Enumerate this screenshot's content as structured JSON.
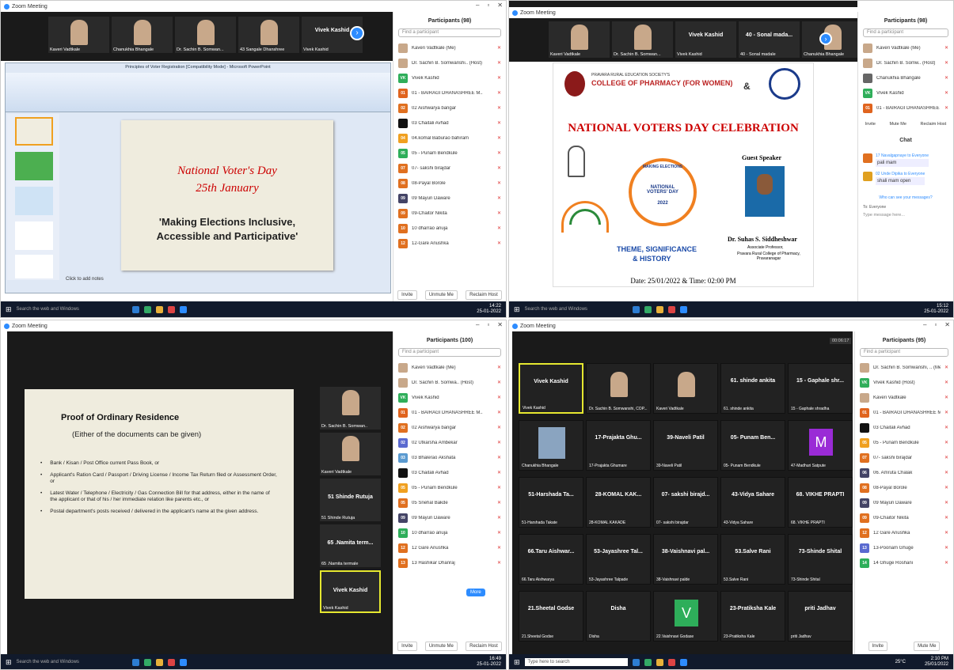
{
  "q1": {
    "title": "Zoom Meeting",
    "thumbs": [
      {
        "name": "Kaveri Vadtkale"
      },
      {
        "name": "Chanukhia Bhangale"
      },
      {
        "name": "Dr. Sachin B. Somwan..."
      },
      {
        "name": "43 Sangale Dhanshree"
      },
      {
        "name": "Vivek Kashid",
        "big": "Vivek Kashid"
      }
    ],
    "ppt_title": "Principles of Voter Registration [Compatibility Mode] - Microsoft PowerPoint",
    "slide_line1": "National Voter's Day",
    "slide_line2": "25th January",
    "slide_line3": "'Making Elections Inclusive, Accessible and Participative'",
    "notes": "Click to add notes",
    "panel_title": "Participants (98)",
    "search": "Find a participant",
    "participants": [
      {
        "n": "Kaveri Vadtkale (Me)",
        "c": "#c8a88a"
      },
      {
        "n": "Dr. Sachin B. Somwanshi.. (Host)",
        "c": "#c8a88a"
      },
      {
        "n": "Vivek Kashid",
        "c": "#2fae5a",
        "i": "VK"
      },
      {
        "n": "01 - BAIRAGI DHANASHREE M..",
        "c": "#e0641e",
        "i": "01"
      },
      {
        "n": "02 Aishwarya bangar",
        "c": "#e07020",
        "i": "02"
      },
      {
        "n": "03 Chaitali Avhad",
        "c": "#111"
      },
      {
        "n": "04.komal Baburao bahiram",
        "c": "#f0a020",
        "i": "04"
      },
      {
        "n": "05 - Punam Bendkule",
        "c": "#2eae5a",
        "i": "05"
      },
      {
        "n": "07- sakshi birajdar",
        "c": "#e07020",
        "i": "07"
      },
      {
        "n": "08-Payal Borole",
        "c": "#e07020",
        "i": "08"
      },
      {
        "n": "09 Mayuri Daware",
        "c": "#444466",
        "i": "09"
      },
      {
        "n": "09-Chaitor Nikita",
        "c": "#e07020",
        "i": "09"
      },
      {
        "n": "10 dharrao anuja",
        "c": "#e07020",
        "i": "10"
      },
      {
        "n": "12-Gare Anushka",
        "c": "#e07020",
        "i": "12"
      }
    ],
    "btn_invite": "Invite",
    "btn_unmute": "Unmute Me",
    "btn_reclaim": "Reclaim Host",
    "search_win": "Search the web and Windows",
    "clock": "14:22",
    "date": "25-01-2022"
  },
  "q2": {
    "title": "Zoom Meeting",
    "thumbs": [
      {
        "name": "Kaveri Vadtkale"
      },
      {
        "name": "Dr. Sachin B. Somwan..."
      },
      {
        "name": "Vivek Kashid",
        "big": "Vivek Kashid"
      },
      {
        "name": "40 - Sonal madale",
        "big": "40 - Sonal mada..."
      },
      {
        "name": "Chanukhia Bhangale"
      }
    ],
    "society": "PRAVARA RURAL EDUCATION SOCIETY'S",
    "college": "COLLEGE OF PHARMACY (FOR WOMEN)",
    "amp": "&",
    "heading": "NATIONAL VOTERS DAY CELEBRATION",
    "badge_top": "MAKING ELECTIONS",
    "badge_mid": "NATIONAL VOTERS' DAY",
    "badge_year": "2022",
    "theme1": "THEME, SIGNIFICANCE",
    "theme2": "& HISTORY",
    "guest_label": "Guest Speaker",
    "speaker": "Dr. Suhas S. Siddheshwar",
    "speaker_role": "Associate Professor,",
    "speaker_org": "Pravara Rural College of Pharmacy, Pravaranagar",
    "datetime": "Date: 25/01/2022 & Time: 02:00 PM",
    "panel_title": "Participants (98)",
    "search": "Find a participant",
    "participants": [
      {
        "n": "Kaveri Vadtkale (Me)",
        "c": "#c8a88a"
      },
      {
        "n": "Dr. Sachin B. Somw.. (Host)",
        "c": "#c8a88a"
      },
      {
        "n": "Chanukhia Bhangale",
        "c": "#666"
      },
      {
        "n": "Vivek Kashid",
        "c": "#2fae5a",
        "i": "VK"
      },
      {
        "n": "01 - BAIRAGI DHANASHREE M..",
        "c": "#e0641e",
        "i": "01"
      }
    ],
    "btn_invite": "Invite",
    "btn_mute": "Mute Me",
    "btn_reclaim": "Reclaim Host",
    "chat_title": "Chat",
    "chat": [
      {
        "from": "17 Navalgapnaye to Everyone",
        "msg": "pali mam",
        "c": "#e07020"
      },
      {
        "from": "02 Unde Dipika to Everyone",
        "msg": "shali mam open",
        "c": "#e0a020"
      }
    ],
    "who_see": "Who can see your messages?",
    "to": "To: Everyone",
    "type_msg": "Type message here...",
    "search_win": "Search the web and Windows",
    "clock": "15:12",
    "date": "25-01-2022"
  },
  "q3": {
    "title": "Zoom Meeting",
    "slide_title": "Proof of Ordinary Residence",
    "slide_sub": "(Either of the documents can be given)",
    "bullets": [
      "Bank / Kisan / Post Office current Pass Book, or",
      "Applicant's Ration Card / Passport / Driving License / Income Tax Return filed or Assessment Order, or",
      "Latest Water / Telephone / Electricity / Gas Connection Bill for that address, either in the name of the applicant or that of his / her immediate relation like parents etc., or",
      "Postal department's posts received / delivered in the applicant's name at the given address."
    ],
    "side_thumbs": [
      {
        "name": "Dr. Sachin B. Somwan..",
        "face": true
      },
      {
        "name": "Kaveri Vadtkale",
        "face": true
      },
      {
        "name": "51 Shinde Rutuja",
        "big": "51 Shinde Rutuja"
      },
      {
        "name": "65 .Namita termale",
        "big": "65 .Namita term..."
      },
      {
        "name": "Vivek Kashid",
        "big": "Vivek Kashid"
      }
    ],
    "panel_title": "Participants (100)",
    "search": "Find a participant",
    "participants": [
      {
        "n": "Kaveri Vadtkale (Me)",
        "c": "#c8a88a"
      },
      {
        "n": "Dr. Sachin B. Somwa.. (Host)",
        "c": "#c8a88a"
      },
      {
        "n": "Vivek Kashid",
        "c": "#2fae5a",
        "i": "VK"
      },
      {
        "n": "01 - BAIRAGI DHANASHREE M..",
        "c": "#e0641e",
        "i": "01"
      },
      {
        "n": "02 Aishwarya bangar",
        "c": "#e07020",
        "i": "02"
      },
      {
        "n": "02 Utkarsha Ambekar",
        "c": "#5a6ad0",
        "i": "02"
      },
      {
        "n": "03 Bhalerao Akshata",
        "c": "#5a9ad0",
        "i": "03"
      },
      {
        "n": "03 Chaitali Avhad",
        "c": "#111"
      },
      {
        "n": "05 - Punam Bendkule",
        "c": "#f0a020",
        "i": "05"
      },
      {
        "n": "05 Snehal Bakde",
        "c": "#e07020",
        "i": "05"
      },
      {
        "n": "09 Mayuri Daware",
        "c": "#444466",
        "i": "09"
      },
      {
        "n": "10 dharrao anuja",
        "c": "#2eae5a",
        "i": "10"
      },
      {
        "n": "12 Gare Anushka",
        "c": "#e07020",
        "i": "12"
      },
      {
        "n": "13 Hashikar Dhanraj",
        "c": "#e07020",
        "i": "13"
      }
    ],
    "more": "More",
    "btn_invite": "Invite",
    "btn_unmute": "Unmute Me",
    "btn_reclaim": "Reclaim Host",
    "search_win": "Search the web and Windows",
    "clock": "16:49",
    "date": "25-01-2022"
  },
  "q4": {
    "title": "Zoom Meeting",
    "timer": "00:06:17",
    "grid": [
      {
        "big": "Vivek Kashid",
        "nm": "Vivek Kashid",
        "hl": true
      },
      {
        "face": true,
        "nm": "Dr. Sachin B. Somwanshi, COP..."
      },
      {
        "face": true,
        "nm": "Kaveri Vadtkale"
      },
      {
        "big": "61. shinde ankita",
        "nm": "61. shinde ankita"
      },
      {
        "big": "15 - Gaphale shr...",
        "nm": "15 - Gaphale shradha"
      },
      {
        "img": true,
        "nm": "Chanukhia Bhangale"
      },
      {
        "big": "17-Prajakta Ghu...",
        "nm": "17-Prajakta Ghumare"
      },
      {
        "big": "39-Naveli Patil",
        "nm": "39-Naveli Patil"
      },
      {
        "big": "05- Punam Ben...",
        "nm": "05- Punam Bendkule"
      },
      {
        "letter": "M",
        "lc": "#9a2bd6",
        "nm": "47-Madhuri Satpute"
      },
      {
        "big": "51-Harshada Ta...",
        "nm": "51-Harshada Takate"
      },
      {
        "big": "28-KOMAL KAK...",
        "nm": "28-KOMAL KAKADE"
      },
      {
        "big": "07- sakshi birajd...",
        "nm": "07- sakshi birajdar"
      },
      {
        "big": "43-Vidya Sahare",
        "nm": "43-Vidya Sahare"
      },
      {
        "big": "68. VIKHE PRAPTI",
        "nm": "68. VIKHE PRAPTI"
      },
      {
        "big": "66.Taru Aishwar...",
        "nm": "66.Taru Aishwarya"
      },
      {
        "big": "53-Jayashree Tal...",
        "nm": "53-Jayashree Talpade"
      },
      {
        "big": "38-Vaishnavi pal...",
        "nm": "38-Vaishnavi palde"
      },
      {
        "big": "53.Salve Rani",
        "nm": "53.Salve Rani"
      },
      {
        "big": "73-Shinde Shital",
        "nm": "73-Shinde Shital"
      },
      {
        "big": "21.Sheetal Godse",
        "nm": "21.Sheetal Godse"
      },
      {
        "big": "Disha",
        "nm": "Disha"
      },
      {
        "letter": "V",
        "lc": "#2eae5a",
        "nm": "22.Vaishnavi Godase"
      },
      {
        "big": "23-Pratiksha Kale",
        "nm": "23-Pratiksha Kale"
      },
      {
        "big": "priti Jadhav",
        "nm": "priti Jadhav"
      }
    ],
    "panel_title": "Participants (95)",
    "search": "Find a participant",
    "participants": [
      {
        "n": "Dr. Sachin B. Somwanshi, .. (Me)",
        "c": "#c8a88a"
      },
      {
        "n": "Vivek Kashid (Host)",
        "c": "#2fae5a",
        "i": "VK"
      },
      {
        "n": "Kaveri Vadtkale",
        "c": "#c8a88a"
      },
      {
        "n": "01 - BAIRAGI DHANASHREE M..",
        "c": "#e0641e",
        "i": "01"
      },
      {
        "n": "03 Chaitali Avhad",
        "c": "#111"
      },
      {
        "n": "05 - Punam Bendkule",
        "c": "#f0a020",
        "i": "05"
      },
      {
        "n": "07- sakshi birajdar",
        "c": "#e07020",
        "i": "07"
      },
      {
        "n": "06. Amruta Chalak",
        "c": "#444466",
        "i": "06"
      },
      {
        "n": "08-Payal Borole",
        "c": "#e07020",
        "i": "08"
      },
      {
        "n": "09 Mayuri Daware",
        "c": "#444466",
        "i": "09"
      },
      {
        "n": "09-Chaitor Nikita",
        "c": "#e07020",
        "i": "09"
      },
      {
        "n": "12 Gare Anushka",
        "c": "#e07020",
        "i": "12"
      },
      {
        "n": "13-Poonam Ghuge",
        "c": "#5a6ad0",
        "i": "13"
      },
      {
        "n": "14 Ghuge Roshani",
        "c": "#2eae5a",
        "i": "14"
      }
    ],
    "btn_invite": "Invite",
    "btn_mute": "Mute Me",
    "search_win": "Type here to search",
    "temp": "25°C",
    "clock": "2:10 PM",
    "date": "25/01/2022"
  }
}
